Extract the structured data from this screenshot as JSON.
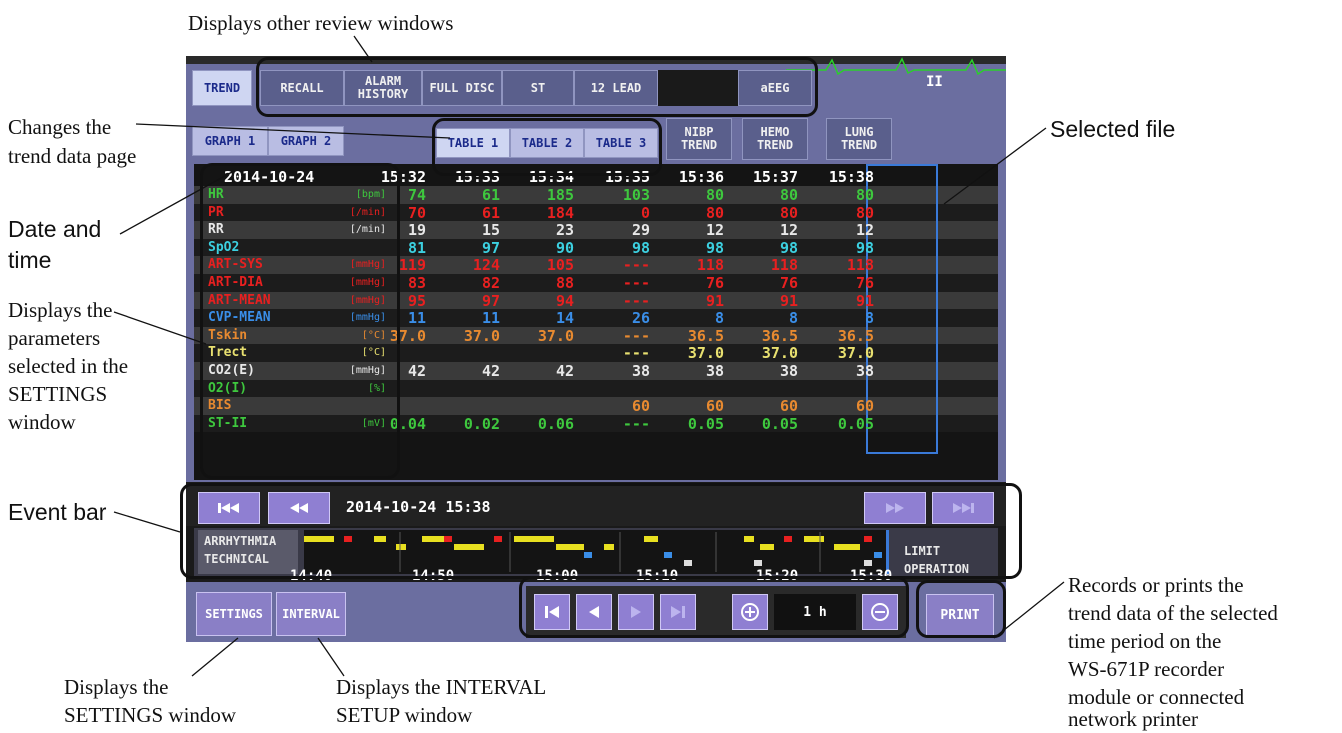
{
  "annotations": {
    "review_windows": "Displays other review windows",
    "changes_page": [
      "Changes the",
      "trend data page"
    ],
    "selected_file": "Selected file",
    "date_time": [
      "Date and",
      "time"
    ],
    "parameters": [
      "Displays the",
      "parameters",
      "selected in the",
      "SETTINGS",
      "window"
    ],
    "event_bar": "Event bar",
    "records_prints": [
      "Records or prints the",
      "trend data of the selected",
      "time period on the",
      "WS-671P recorder",
      "module or connected",
      "network printer"
    ],
    "settings_window": [
      "Displays the",
      "SETTINGS window"
    ],
    "interval_window": [
      "Displays the INTERVAL",
      "SETUP window"
    ]
  },
  "top_tabs": {
    "trend": "TREND",
    "recall": "RECALL",
    "alarm_history_1": "ALARM",
    "alarm_history_2": "HISTORY",
    "full_disc": "FULL DISC",
    "st": "ST",
    "lead12": "12 LEAD",
    "aeeg": "aEEG",
    "lead_label": "II"
  },
  "page_tabs": {
    "graph1": "GRAPH 1",
    "graph2": "GRAPH 2",
    "table1": "TABLE 1",
    "table2": "TABLE 2",
    "table3": "TABLE 3",
    "nibp_1": "NIBP",
    "nibp_2": "TREND",
    "hemo_1": "HEMO",
    "hemo_2": "TREND",
    "lung_1": "LUNG",
    "lung_2": "TREND"
  },
  "table": {
    "date": "2014-10-24",
    "times": [
      "15:32",
      "15:33",
      "15:34",
      "15:35",
      "15:36",
      "15:37",
      "15:38"
    ],
    "rows": [
      {
        "name": "HR",
        "unit": "[bpm]",
        "color": "#3ec83e",
        "values": [
          "74",
          "61",
          "185",
          "103",
          "80",
          "80",
          "80"
        ]
      },
      {
        "name": "PR",
        "unit": "[/min]",
        "color": "#e82020",
        "values": [
          "70",
          "61",
          "184",
          "0",
          "80",
          "80",
          "80"
        ]
      },
      {
        "name": "RR",
        "unit": "[/min]",
        "color": "#e8e8e8",
        "values": [
          "19",
          "15",
          "23",
          "29",
          "12",
          "12",
          "12"
        ]
      },
      {
        "name": "SpO2",
        "unit": "",
        "color": "#3cd0e0",
        "values": [
          "81",
          "97",
          "90",
          "98",
          "98",
          "98",
          "98"
        ]
      },
      {
        "name": "ART-SYS",
        "unit": "[mmHg]",
        "color": "#e82020",
        "values": [
          "119",
          "124",
          "105",
          "---",
          "118",
          "118",
          "118"
        ]
      },
      {
        "name": "ART-DIA",
        "unit": "[mmHg]",
        "color": "#e82020",
        "values": [
          "83",
          "82",
          "88",
          "---",
          "76",
          "76",
          "76"
        ]
      },
      {
        "name": "ART-MEAN",
        "unit": "[mmHg]",
        "color": "#e82020",
        "values": [
          "95",
          "97",
          "94",
          "---",
          "91",
          "91",
          "91"
        ]
      },
      {
        "name": "CVP-MEAN",
        "unit": "[mmHg]",
        "color": "#3a8ee8",
        "values": [
          "11",
          "11",
          "14",
          "26",
          "8",
          "8",
          "8"
        ]
      },
      {
        "name": "Tskin",
        "unit": "[°C]",
        "color": "#e88a30",
        "values": [
          "37.0",
          "37.0",
          "37.0",
          "---",
          "36.5",
          "36.5",
          "36.5"
        ]
      },
      {
        "name": "Trect",
        "unit": "[°C]",
        "color": "#e8e070",
        "values": [
          "",
          "",
          "",
          "---",
          "37.0",
          "37.0",
          "37.0"
        ]
      },
      {
        "name": "CO2(E)",
        "unit": "[mmHg]",
        "color": "#e8e8e8",
        "values": [
          "42",
          "42",
          "42",
          "38",
          "38",
          "38",
          "38"
        ]
      },
      {
        "name": "O2(I)",
        "unit": "[%]",
        "color": "#3ec83e",
        "values": [
          "",
          "",
          "",
          "",
          "",
          "",
          ""
        ]
      },
      {
        "name": "BIS",
        "unit": "",
        "color": "#e88a30",
        "values": [
          "",
          "",
          "",
          "60",
          "60",
          "60",
          "60"
        ]
      },
      {
        "name": "ST-II",
        "unit": "[mV]",
        "color": "#3ec83e",
        "values": [
          "0.04",
          "0.02",
          "0.06",
          "---",
          "0.05",
          "0.05",
          "0.05"
        ]
      }
    ]
  },
  "event_bar": {
    "datetime": "2014-10-24 15:38",
    "arrhythmia": "ARRHYTHMIA",
    "technical": "TECHNICAL",
    "limit": "LIMIT",
    "operation": "OPERATION",
    "times": [
      "14:40",
      "14:50",
      "15:00",
      "15:10",
      "15:20",
      "15:30"
    ]
  },
  "bottom": {
    "settings": "SETTINGS",
    "interval": "INTERVAL",
    "span": "1 h",
    "print": "PRINT"
  }
}
